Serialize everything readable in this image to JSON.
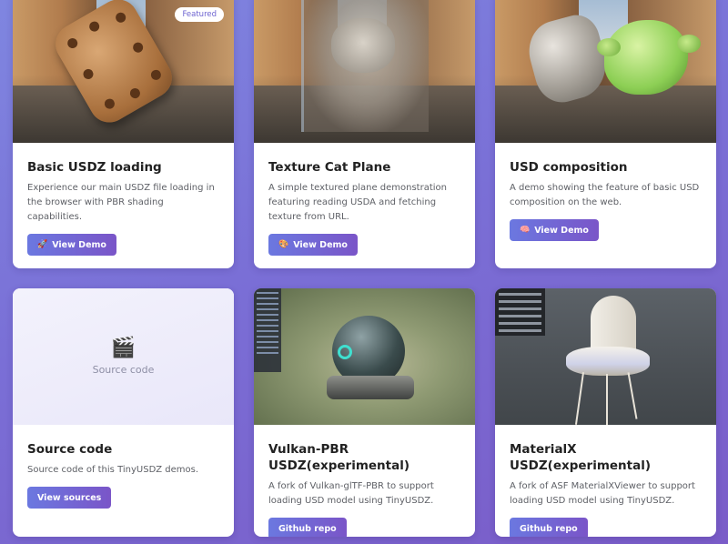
{
  "cards": [
    {
      "title": "Basic USDZ loading",
      "desc": "Experience our main USDZ file loading in the browser with PBR shading capabilities.",
      "button": "View Demo",
      "button_icon": "rocket-icon",
      "badge": "Featured"
    },
    {
      "title": "Texture Cat Plane",
      "desc": "A simple textured plane demonstration featuring reading USDA and fetching texture from URL.",
      "button": "View Demo",
      "button_icon": "palette-icon"
    },
    {
      "title": "USD composition",
      "desc": "A demo showing the feature of basic USD composition on the web.",
      "button": "View Demo",
      "button_icon": "brain-icon"
    },
    {
      "title": "Source code",
      "desc": "Source code of this TinyUSDZ demos.",
      "button": "View sources",
      "image_label": "Source code",
      "image_icon": "clapper-board-icon"
    },
    {
      "title": "Vulkan-PBR USDZ(experimental)",
      "desc": "A fork of Vulkan-glTF-PBR to support loading USD model using TinyUSDZ.",
      "button": "Github repo"
    },
    {
      "title": "MaterialX USDZ(experimental)",
      "desc": "A fork of ASF MaterialXViewer to support loading USD model using TinyUSDZ.",
      "button": "Github repo"
    }
  ],
  "colors": {
    "accent_start": "#6b78e0",
    "accent_end": "#7a55c8",
    "page_bg": "#7a6fd6"
  }
}
